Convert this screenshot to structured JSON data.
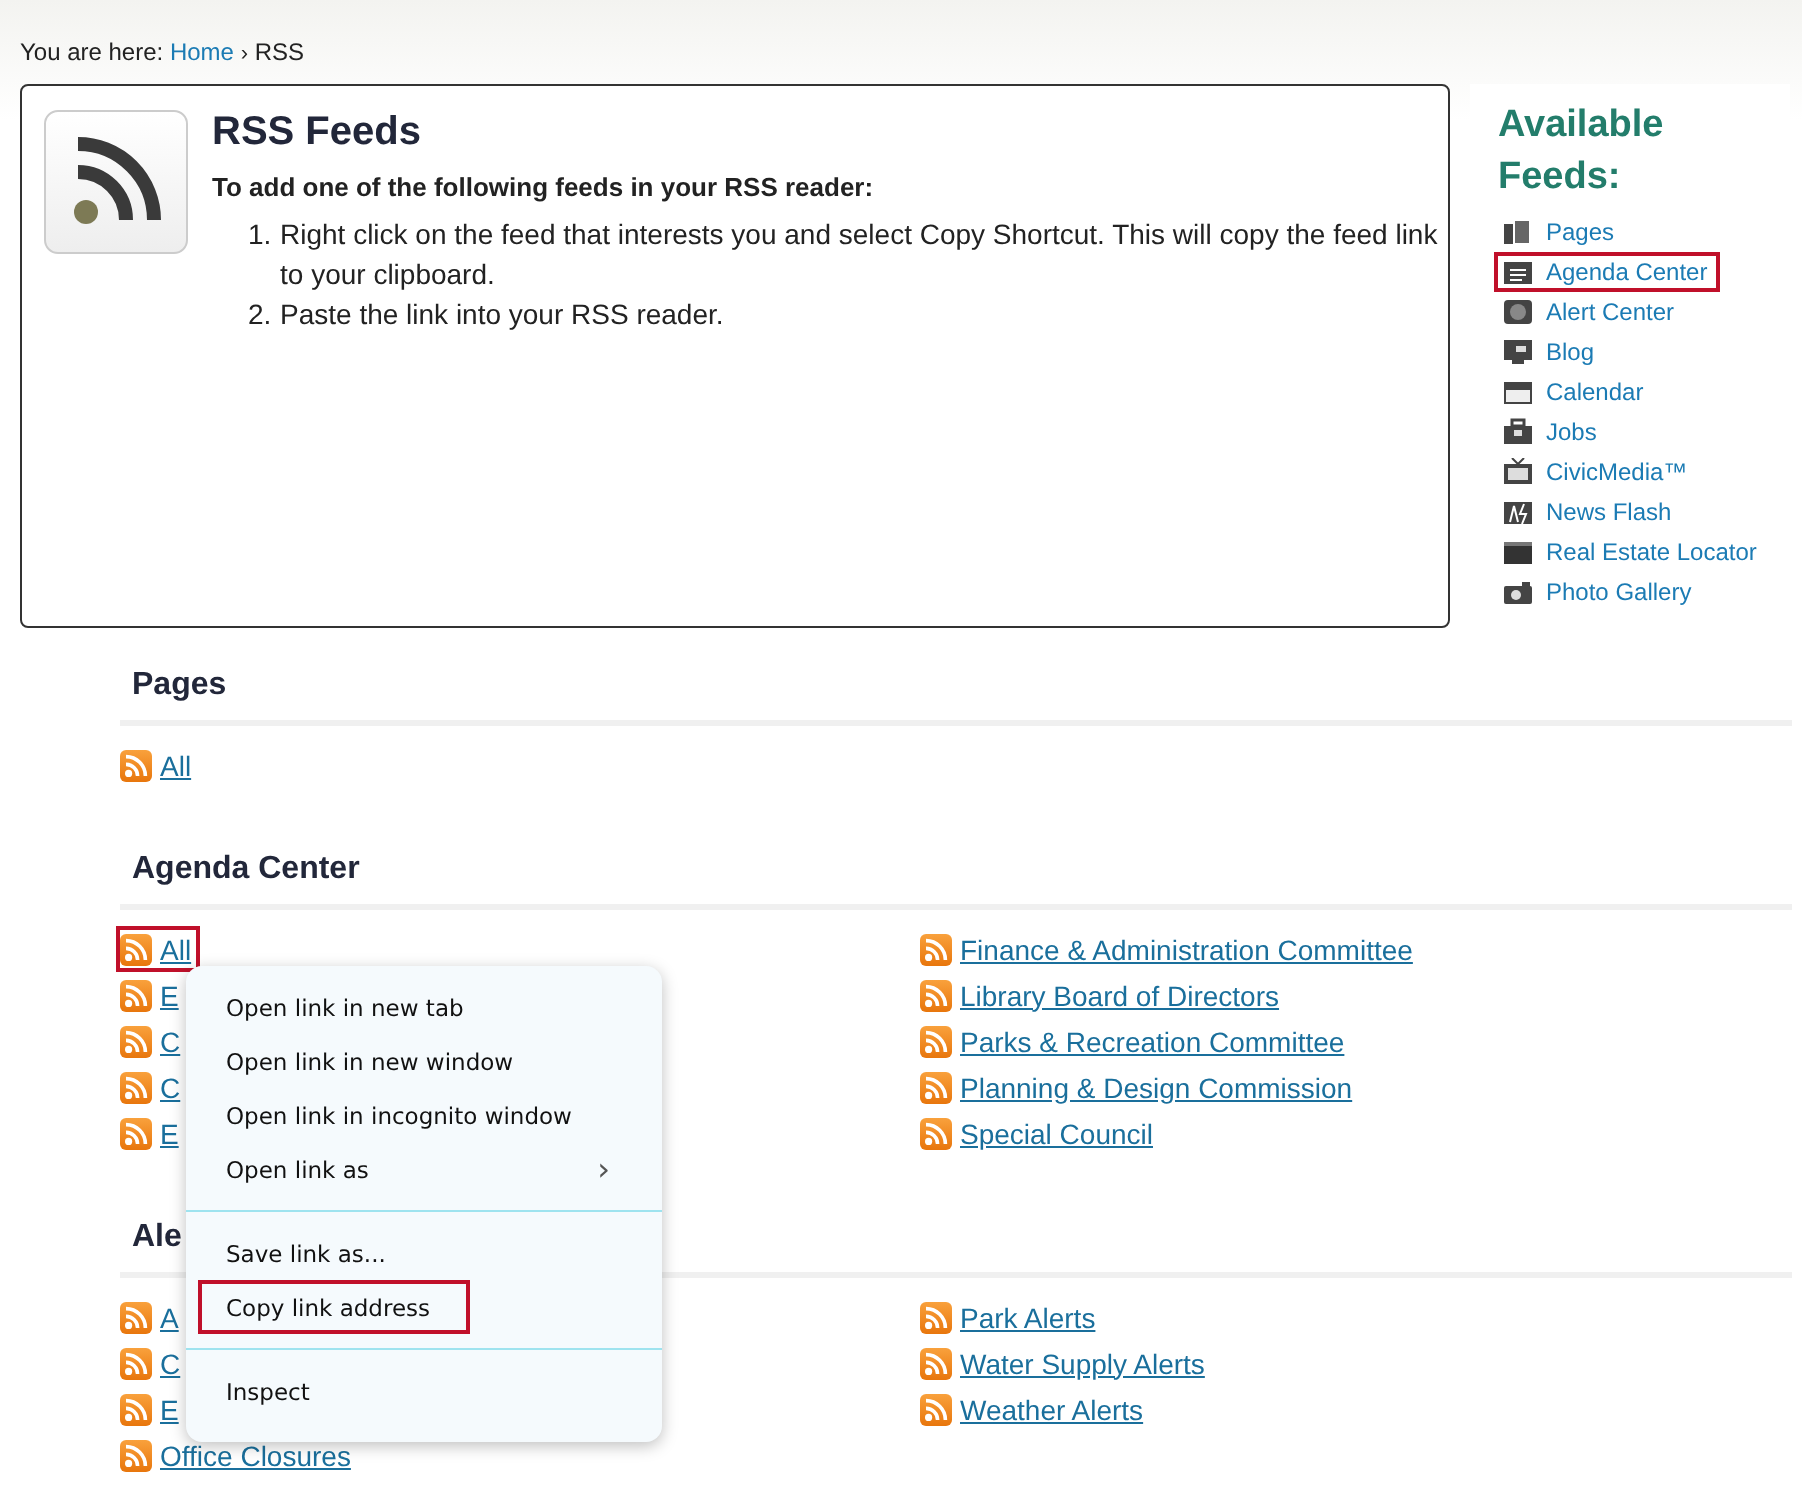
{
  "breadcrumb": {
    "label": "You are here:",
    "links": [
      {
        "text": "Home"
      }
    ],
    "separator": "›",
    "current": "RSS"
  },
  "intro": {
    "title": "RSS Feeds",
    "subtitle": "To add one of the following feeds in your RSS reader:",
    "steps": [
      {
        "number": "1.",
        "text": "Right click on the feed that interests you and select Copy Shortcut. This will copy the feed link to your clipboard."
      },
      {
        "number": "2.",
        "text": "Paste the link into your RSS reader."
      }
    ]
  },
  "sidebar": {
    "title": "Available Feeds:",
    "items": [
      {
        "label": "Pages",
        "highlighted": false
      },
      {
        "label": "Agenda Center",
        "highlighted": true
      },
      {
        "label": "Alert Center",
        "highlighted": false
      },
      {
        "label": "Blog",
        "highlighted": false
      },
      {
        "label": "Calendar",
        "highlighted": false
      },
      {
        "label": "Jobs",
        "highlighted": false
      },
      {
        "label": "CivicMedia™",
        "highlighted": false
      },
      {
        "label": "News Flash",
        "highlighted": false
      },
      {
        "label": "Real Estate Locator",
        "highlighted": false
      },
      {
        "label": "Photo Gallery",
        "highlighted": false
      }
    ]
  },
  "sections": [
    {
      "title": "Pages",
      "left": [
        {
          "label": "All",
          "highlighted": false
        }
      ]
    },
    {
      "title": "Agenda Center",
      "left": [
        {
          "label": "All",
          "highlighted": true
        },
        {
          "label": "E",
          "highlighted": false
        },
        {
          "label": "C",
          "highlighted": false
        },
        {
          "label": "C",
          "highlighted": false
        },
        {
          "label": "E",
          "highlighted": false
        }
      ],
      "right": [
        {
          "label": "Finance & Administration Committee",
          "highlighted": false
        },
        {
          "label": "Library Board of Directors",
          "highlighted": false
        },
        {
          "label": "Parks & Recreation Committee",
          "highlighted": false
        },
        {
          "label": "Planning & Design Commission",
          "highlighted": false
        },
        {
          "label": "Special Council",
          "highlighted": false
        }
      ]
    },
    {
      "title": "Ale",
      "left": [
        {
          "label": "A",
          "highlighted": false
        },
        {
          "label": "C",
          "highlighted": false
        },
        {
          "label": "E",
          "highlighted": false
        },
        {
          "label": "Office Closures",
          "highlighted": false
        }
      ],
      "right": [
        {
          "label": "Park Alerts",
          "highlighted": false
        },
        {
          "label": "Water Supply Alerts",
          "highlighted": false
        },
        {
          "label": "Weather Alerts",
          "highlighted": false
        }
      ]
    }
  ],
  "context_menu": {
    "items": [
      {
        "kind": "item",
        "label": "Open link in new tab",
        "highlighted": false
      },
      {
        "kind": "item",
        "label": "Open link in new window",
        "highlighted": false
      },
      {
        "kind": "item",
        "label": "Open link in incognito window",
        "highlighted": false
      },
      {
        "kind": "submenu",
        "label": "Open link as",
        "arrow": "›",
        "highlighted": false
      },
      {
        "kind": "separator"
      },
      {
        "kind": "item",
        "label": "Save link as...",
        "highlighted": false
      },
      {
        "kind": "item",
        "label": "Copy link address",
        "highlighted": true
      },
      {
        "kind": "separator"
      },
      {
        "kind": "item",
        "label": "Inspect",
        "highlighted": false
      }
    ]
  }
}
